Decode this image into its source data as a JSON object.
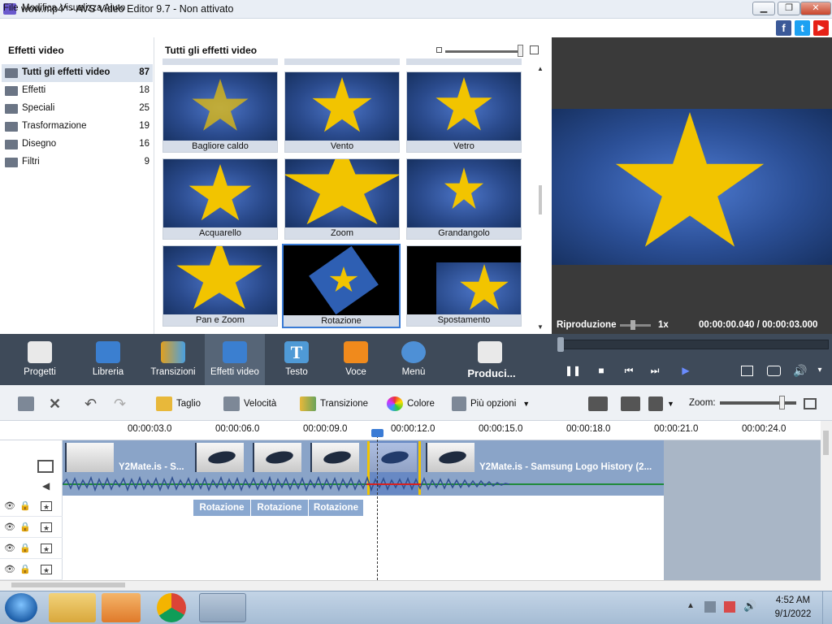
{
  "window": {
    "title": "wow.mp4* - AVS Video Editor 9.7 - Non attivato",
    "min": "▁",
    "max": "❐",
    "close": "✕"
  },
  "menu": [
    "File",
    "Modifica",
    "Visualizza",
    "Aiuto"
  ],
  "social": [
    "f",
    "t",
    "▶"
  ],
  "left_panel": {
    "header": "Effetti video",
    "items": [
      {
        "label": "Tutti gli effetti video",
        "count": "87"
      },
      {
        "label": "Effetti",
        "count": "18"
      },
      {
        "label": "Speciali",
        "count": "25"
      },
      {
        "label": "Trasformazione",
        "count": "19"
      },
      {
        "label": "Disegno",
        "count": "16"
      },
      {
        "label": "Filtri",
        "count": "9"
      }
    ]
  },
  "mid_panel": {
    "header": "Tutti gli effetti video",
    "effects": [
      "Bagliore caldo",
      "Vento",
      "Vetro",
      "Acquarello",
      "Zoom",
      "Grandangolo",
      "Pan e Zoom",
      "Rotazione",
      "Spostamento"
    ]
  },
  "preview": {
    "label": "Riproduzione",
    "speed": "1x",
    "time": "00:00:00.040  /  00:00:03.000"
  },
  "toolbar": [
    {
      "label": "Progetti",
      "icon": "clapper-icon"
    },
    {
      "label": "Libreria",
      "icon": "film-icon"
    },
    {
      "label": "Transizioni",
      "icon": "transition-icon"
    },
    {
      "label": "Effetti video",
      "icon": "video-effects-icon"
    },
    {
      "label": "Testo",
      "icon": "text-icon"
    },
    {
      "label": "Voce",
      "icon": "microphone-icon"
    },
    {
      "label": "Menù",
      "icon": "disc-menu-icon"
    },
    {
      "label": "Produci...",
      "icon": "produce-icon"
    }
  ],
  "playback": {
    "play": "❚❚",
    "stop": "■",
    "prev": "⏮",
    "next": "⏭",
    "mark": "▶"
  },
  "edit_toolbar": {
    "taglio": "Taglio",
    "velocita": "Velocità",
    "transizione": "Transizione",
    "colore": "Colore",
    "piu_opzioni": "Più opzioni",
    "zoom": "Zoom:"
  },
  "ruler": [
    "00:00:03.0",
    "00:00:06.0",
    "00:00:09.0",
    "00:00:12.0",
    "00:00:15.0",
    "00:00:18.0",
    "00:00:21.0",
    "00:00:24.0"
  ],
  "timeline": {
    "clip1": "Y2Mate.is - S...",
    "clip2": "Y2Mate.is - Samsung Logo History (2...",
    "fx": [
      "Rotazione",
      "Rotazione",
      "Rotazione"
    ]
  },
  "taskbar": {
    "time": "4:52 AM",
    "date": "9/1/2022"
  }
}
